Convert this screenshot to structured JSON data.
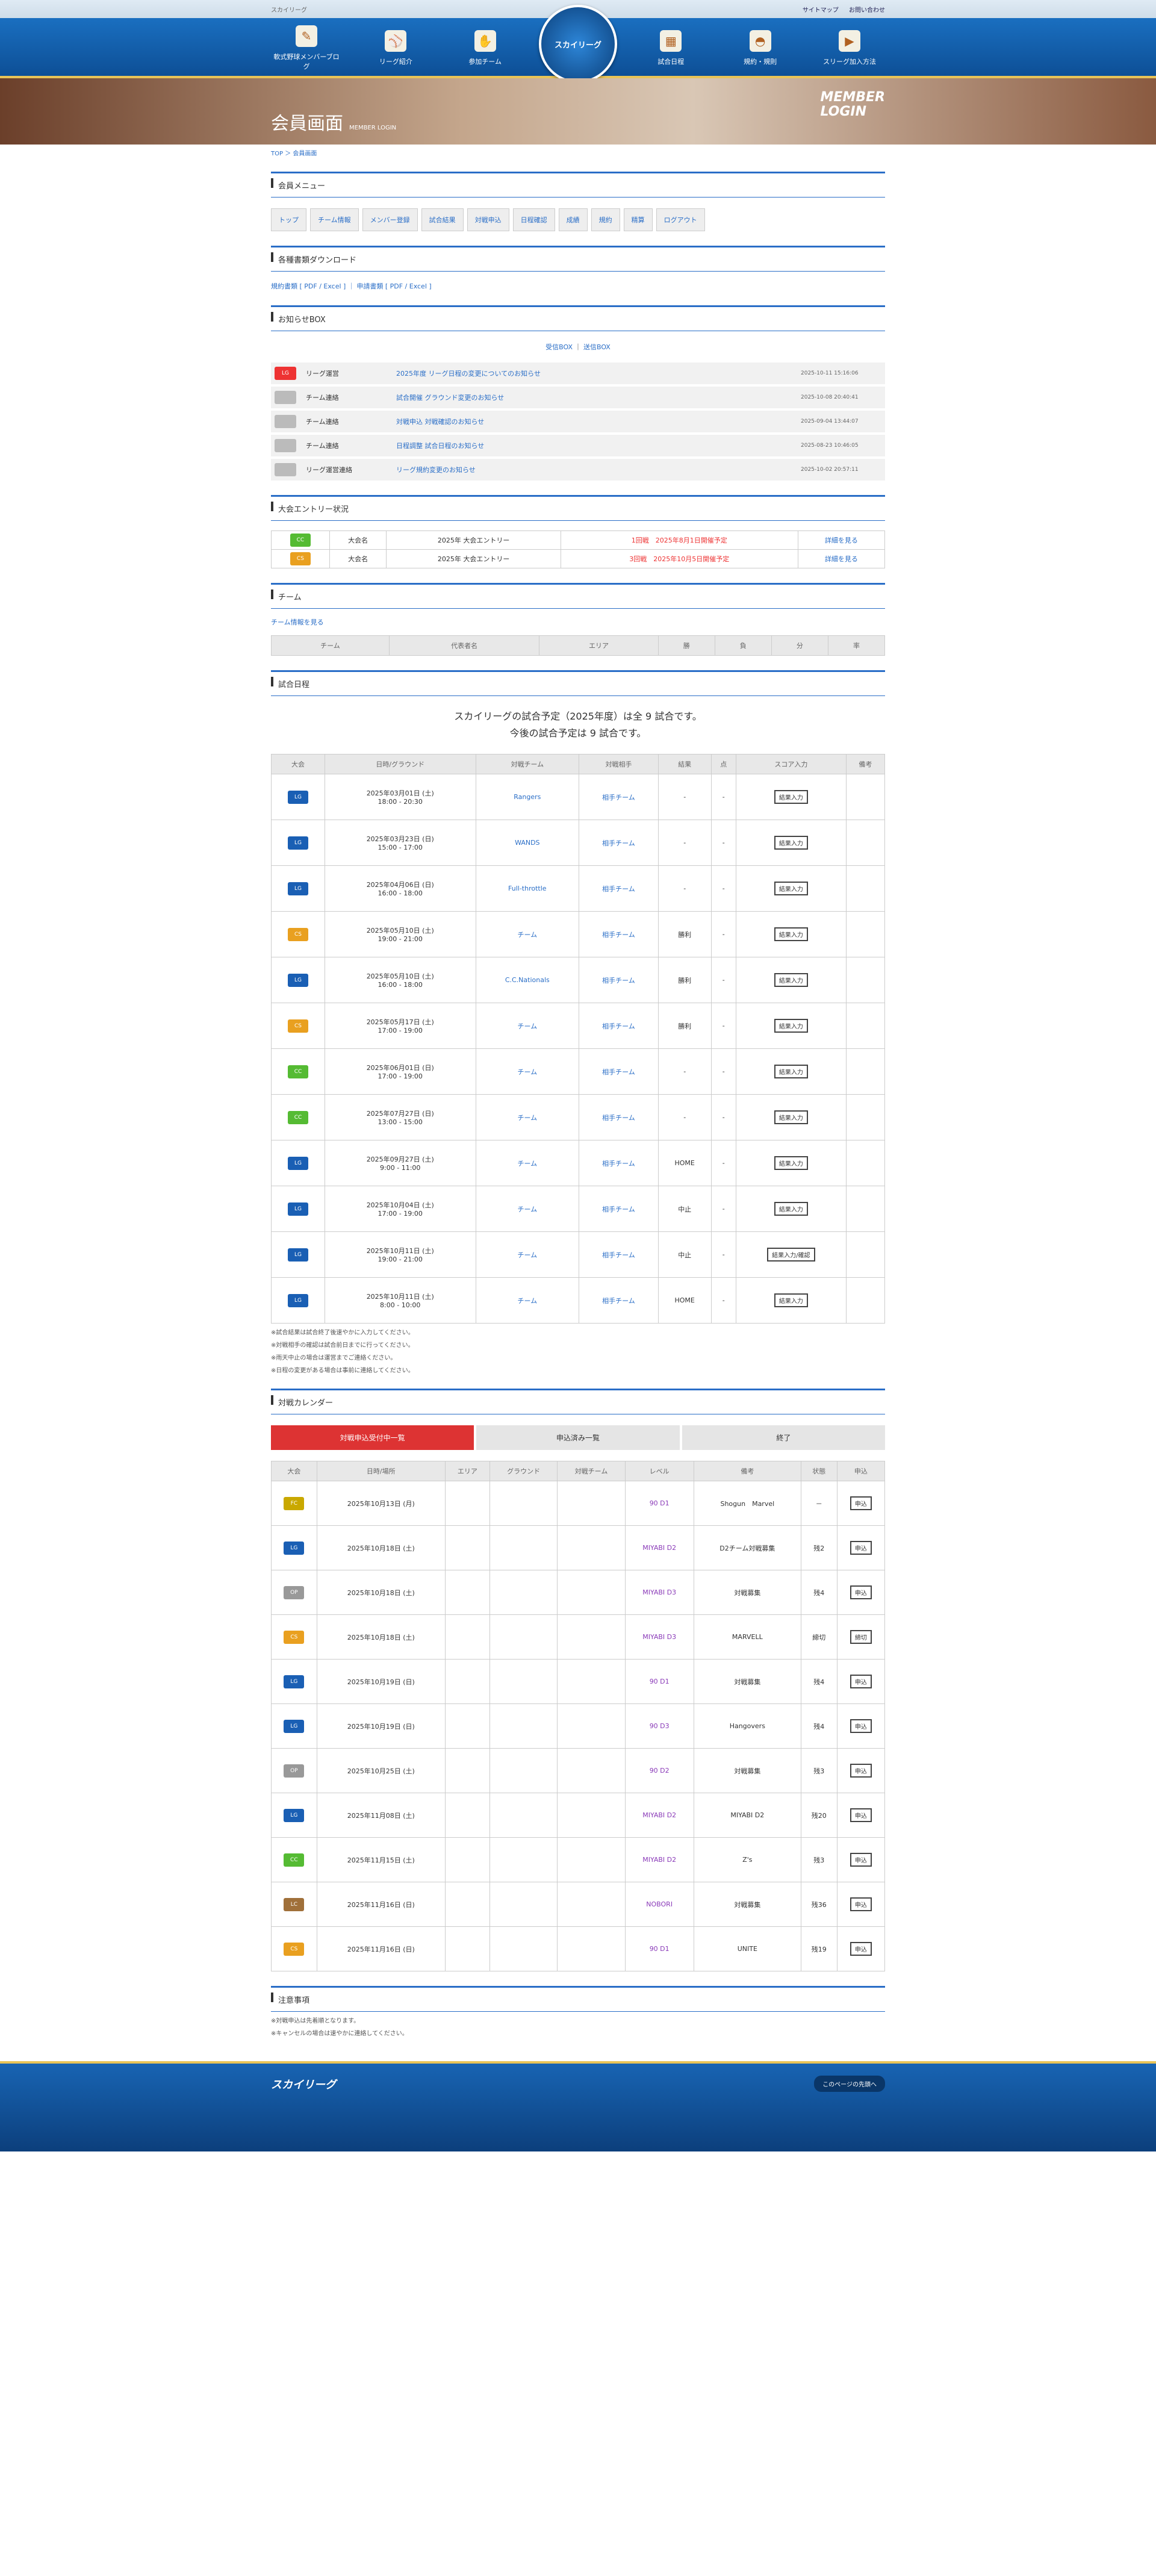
{
  "header": {
    "site_desc": "スカイリーグ",
    "util": [
      "サイトマップ",
      "お問い合わせ"
    ],
    "nav": [
      "軟式野球メンバーブログ",
      "リーグ紹介",
      "参加チーム",
      "試合日程",
      "規約・規則",
      "スリーグ加入方法"
    ],
    "logo_text": "スカイリーグ"
  },
  "hero": {
    "title": "会員画面",
    "sub": "MEMBER LOGIN",
    "ml1": "MEMBER",
    "ml2": "LOGIN"
  },
  "crumb": "TOP ＞ 会員画面",
  "sections": {
    "menu": "会員メニュー",
    "docs": "各種書類ダウンロード",
    "box": "お知らせBOX",
    "ent": "大会エントリー状況",
    "team": "チーム",
    "sched": "試合日程",
    "cal": "対戦カレンダー",
    "bottom": "注意事項"
  },
  "menu_tabs": [
    "トップ",
    "チーム情報",
    "メンバー登録",
    "試合結果",
    "対戦申込",
    "日程確認",
    "成績",
    "規約",
    "精算",
    "ログアウト"
  ],
  "docs_line": "規約書類 [ PDF / Excel ] ｜ 申請書類 [ PDF / Excel ]",
  "box_links": [
    "受信BOX",
    "送信BOX"
  ],
  "announcements": [
    {
      "tag": "LG",
      "cat": "リーグ運営",
      "title": "2025年度 リーグ日程の変更についてのお知らせ",
      "date": "2025-10-11 15:16:06",
      "color": "#e33"
    },
    {
      "tag": "",
      "cat": "チーム連絡",
      "title": "試合開催 グラウンド変更のお知らせ",
      "date": "2025-10-08 20:40:41",
      "color": "#bbb"
    },
    {
      "tag": "",
      "cat": "チーム連絡",
      "title": "対戦申込 対戦確認のお知らせ",
      "date": "2025-09-04 13:44:07",
      "color": "#bbb"
    },
    {
      "tag": "",
      "cat": "チーム連絡",
      "title": "日程調整 試合日程のお知らせ",
      "date": "2025-08-23 10:46:05",
      "color": "#bbb"
    },
    {
      "tag": "",
      "cat": "リーグ運営連絡",
      "title": "リーグ規約変更のお知らせ",
      "date": "2025-10-02 20:57:11",
      "color": "#bbb"
    }
  ],
  "entries": [
    {
      "tag": "CC",
      "color": "#5b3",
      "div": "大会名",
      "name": "2025年 大会エントリー",
      "status": "1回戦　2025年8月1日開催予定",
      "link": "詳細を見る"
    },
    {
      "tag": "CS",
      "color": "#e9a020",
      "div": "大会名",
      "name": "2025年 大会エントリー",
      "status": "3回戦　2025年10月5日開催予定",
      "link": "詳細を見る"
    }
  ],
  "team_link": "チーム情報を見る",
  "team_cols": [
    "チーム",
    "代表者名",
    "エリア",
    "勝",
    "負",
    "分",
    "率"
  ],
  "sched_head1": "スカイリーグの試合予定（2025年度）は全 9 試合です。",
  "sched_head2": "今後の試合予定は 9 試合です。",
  "sched_cols": [
    "大会",
    "日時/グラウンド",
    "対戦チーム",
    "対戦相手",
    "結果",
    "点",
    "スコア入力",
    "備考"
  ],
  "games": [
    {
      "tag": "LG",
      "color": "#1a5fb4",
      "date": "2025年03月01日 (土)",
      "time": "18:00 - 20:30",
      "team": "Rangers",
      "opp": "相手チーム",
      "res": "-",
      "btn": "結果入力"
    },
    {
      "tag": "LG",
      "color": "#1a5fb4",
      "date": "2025年03月23日 (日)",
      "time": "15:00 - 17:00",
      "team": "WANDS",
      "opp": "相手チーム",
      "res": "-",
      "btn": "結果入力"
    },
    {
      "tag": "LG",
      "color": "#1a5fb4",
      "date": "2025年04月06日 (日)",
      "time": "16:00 - 18:00",
      "team": "Full-throttle",
      "opp": "相手チーム",
      "res": "-",
      "btn": "結果入力"
    },
    {
      "tag": "CS",
      "color": "#e9a020",
      "date": "2025年05月10日 (土)",
      "time": "19:00 - 21:00",
      "team": "チーム",
      "opp": "相手チーム",
      "res": "勝利",
      "btn": "結果入力"
    },
    {
      "tag": "LG",
      "color": "#1a5fb4",
      "date": "2025年05月10日 (土)",
      "time": "16:00 - 18:00",
      "team": "C.C.Nationals",
      "opp": "相手チーム",
      "res": "勝利",
      "btn": "結果入力"
    },
    {
      "tag": "CS",
      "color": "#e9a020",
      "date": "2025年05月17日 (土)",
      "time": "17:00 - 19:00",
      "team": "チーム",
      "opp": "相手チーム",
      "res": "勝利",
      "btn": "結果入力"
    },
    {
      "tag": "CC",
      "color": "#5b3",
      "date": "2025年06月01日 (日)",
      "time": "17:00 - 19:00",
      "team": "チーム",
      "opp": "相手チーム",
      "res": "-",
      "btn": "結果入力"
    },
    {
      "tag": "CC",
      "color": "#5b3",
      "date": "2025年07月27日 (日)",
      "time": "13:00 - 15:00",
      "team": "チーム",
      "opp": "相手チーム",
      "res": "-",
      "btn": "結果入力"
    },
    {
      "tag": "LG",
      "color": "#1a5fb4",
      "date": "2025年09月27日 (土)",
      "time": "9:00 - 11:00",
      "team": "チーム",
      "opp": "相手チーム",
      "res": "HOME",
      "btn": "結果入力"
    },
    {
      "tag": "LG",
      "color": "#1a5fb4",
      "date": "2025年10月04日 (土)",
      "time": "17:00 - 19:00",
      "team": "チーム",
      "opp": "相手チーム",
      "res": "中止",
      "btn": "結果入力"
    },
    {
      "tag": "LG",
      "color": "#1a5fb4",
      "date": "2025年10月11日 (土)",
      "time": "19:00 - 21:00",
      "team": "チーム",
      "opp": "相手チーム",
      "res": "中止",
      "btn": "結果入力/確認"
    },
    {
      "tag": "LG",
      "color": "#1a5fb4",
      "date": "2025年10月11日 (土)",
      "time": "8:00 - 10:00",
      "team": "チーム",
      "opp": "相手チーム",
      "res": "HOME",
      "btn": "結果入力"
    }
  ],
  "notes": [
    "※試合結果は試合終了後速やかに入力してください。",
    "※対戦相手の確認は試合前日までに行ってください。",
    "※雨天中止の場合は運営までご連絡ください。",
    "※日程の変更がある場合は事前に連絡してください。"
  ],
  "subtabs": [
    "対戦申込受付中一覧",
    "申込済み一覧",
    "終了"
  ],
  "cal_cols": [
    "大会",
    "日時/場所",
    "エリア",
    "グラウンド",
    "対戦チーム",
    "レベル",
    "備考",
    "状態",
    "申込"
  ],
  "cal": [
    {
      "tag": "FC",
      "color": "#c9a800",
      "date": "2025年10月13日 (月)",
      "lv": "90 D1",
      "note": "Shogun　Marvel",
      "st": "－",
      "btn": "申込"
    },
    {
      "tag": "LG",
      "color": "#1a5fb4",
      "date": "2025年10月18日 (土)",
      "lv": "MIYABI D2",
      "note": "D2チーム対戦募集",
      "st": "残2",
      "btn": "申込"
    },
    {
      "tag": "OP",
      "color": "#999",
      "date": "2025年10月18日 (土)",
      "lv": "MIYABI D3",
      "note": "対戦募集",
      "st": "残4",
      "btn": "申込"
    },
    {
      "tag": "CS",
      "color": "#e9a020",
      "date": "2025年10月18日 (土)",
      "lv": "MIYABI D3",
      "note": "MARVELL",
      "st": "締切",
      "btn": "締切"
    },
    {
      "tag": "LG",
      "color": "#1a5fb4",
      "date": "2025年10月19日 (日)",
      "lv": "90 D1",
      "note": "対戦募集",
      "st": "残4",
      "btn": "申込"
    },
    {
      "tag": "LG",
      "color": "#1a5fb4",
      "date": "2025年10月19日 (日)",
      "lv": "90 D3",
      "note": "Hangovers",
      "st": "残4",
      "btn": "申込"
    },
    {
      "tag": "OP",
      "color": "#999",
      "date": "2025年10月25日 (土)",
      "lv": "90 D2",
      "note": "対戦募集",
      "st": "残3",
      "btn": "申込"
    },
    {
      "tag": "LG",
      "color": "#1a5fb4",
      "date": "2025年11月08日 (土)",
      "lv": "MIYABI D2",
      "note": "MIYABI D2",
      "st": "残20",
      "btn": "申込"
    },
    {
      "tag": "CC",
      "color": "#5b3",
      "date": "2025年11月15日 (土)",
      "lv": "MIYABI D2",
      "note": "Z's",
      "st": "残3",
      "btn": "申込"
    },
    {
      "tag": "LC",
      "color": "#a0703a",
      "date": "2025年11月16日 (日)",
      "lv": "NOBORI",
      "note": "対戦募集",
      "st": "残36",
      "btn": "申込"
    },
    {
      "tag": "CS",
      "color": "#e9a020",
      "date": "2025年11月16日 (日)",
      "lv": "90 D1",
      "note": "UNITE",
      "st": "残19",
      "btn": "申込"
    }
  ],
  "bottom_notes": [
    "※対戦申込は先着順となります。",
    "※キャンセルの場合は速やかに連絡してください。"
  ],
  "footer": {
    "logo": "スカイリーグ",
    "top": "このページの先頭へ"
  }
}
